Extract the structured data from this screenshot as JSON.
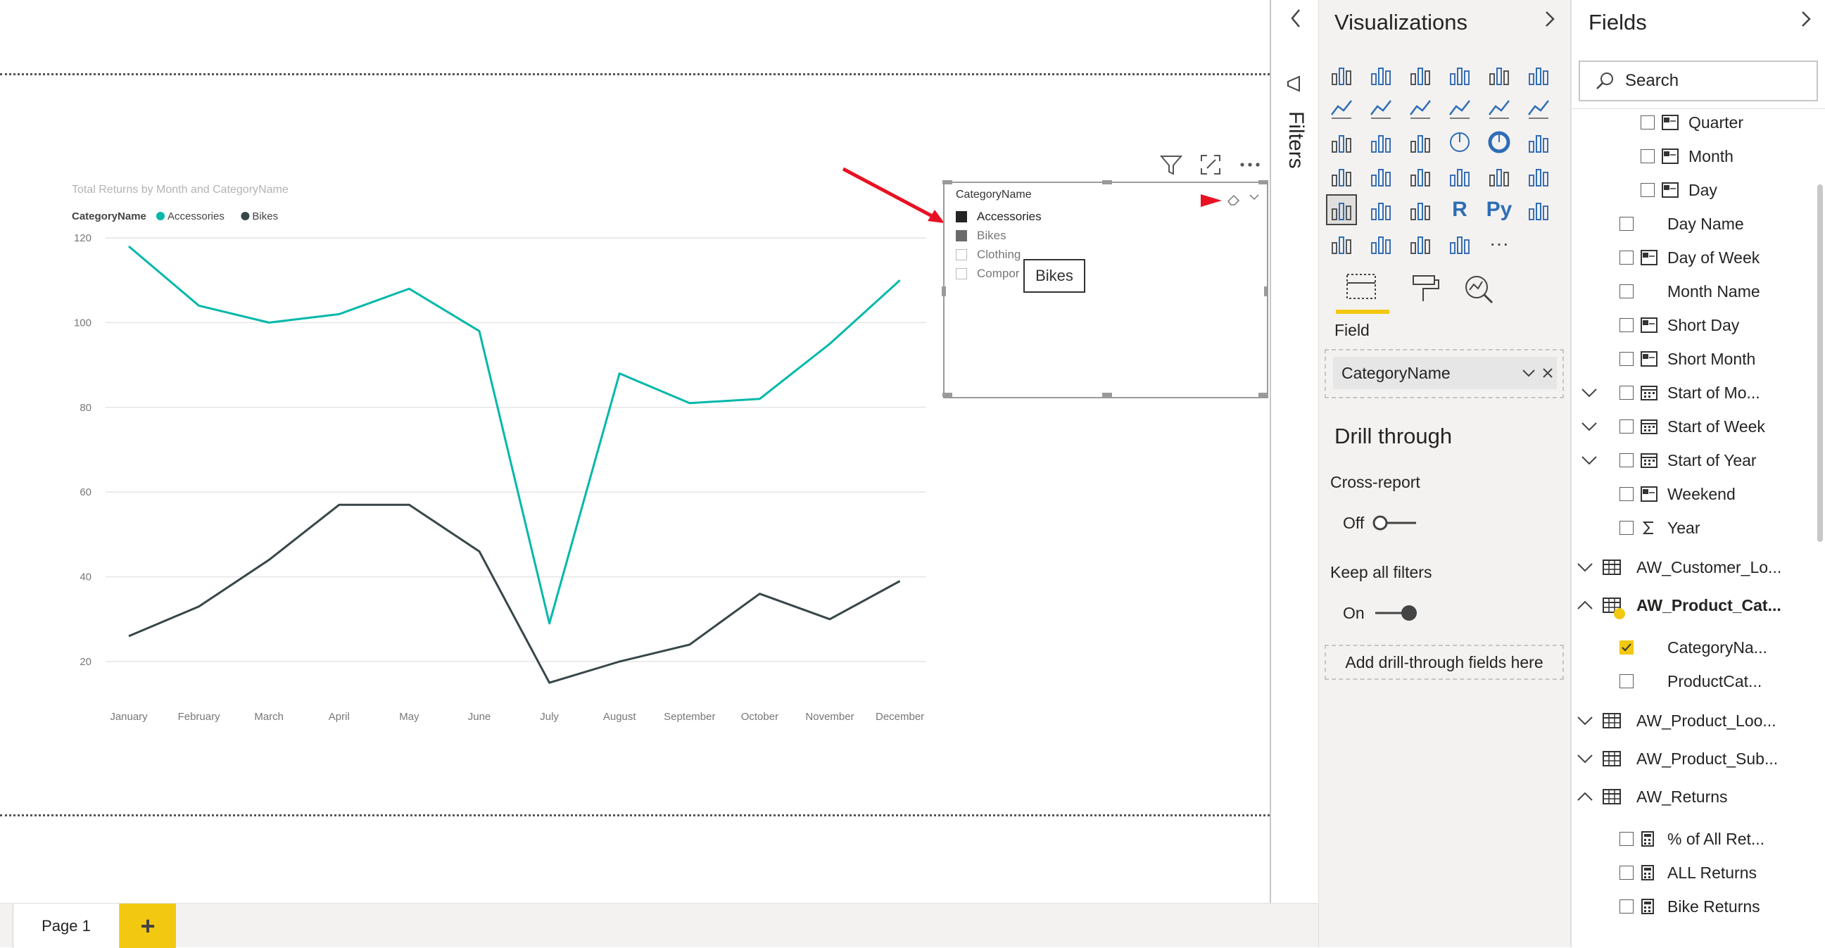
{
  "canvas": {
    "visual_header": {
      "filter_icon": "filter-icon",
      "focus_icon": "focus-mode-icon",
      "more_icon": "more-options-icon"
    }
  },
  "chart_data": {
    "type": "line",
    "title": "Total Returns by Month and CategoryName",
    "legend_title": "CategoryName",
    "legend_placement": "top-left",
    "categories": [
      "January",
      "February",
      "March",
      "April",
      "May",
      "June",
      "July",
      "August",
      "September",
      "October",
      "November",
      "December"
    ],
    "series": [
      {
        "name": "Accessories",
        "color": "#01b8aa",
        "values": [
          118,
          104,
          100,
          102,
          108,
          98,
          29,
          88,
          81,
          82,
          95,
          110
        ]
      },
      {
        "name": "Bikes",
        "color": "#374649",
        "values": [
          26,
          33,
          44,
          57,
          57,
          46,
          15,
          20,
          24,
          36,
          30,
          39
        ]
      }
    ],
    "yticks": [
      "120",
      "100",
      "80",
      "60",
      "40",
      "20"
    ],
    "ylim": [
      15,
      125
    ],
    "grid": true
  },
  "slicer": {
    "title": "CategoryName",
    "items": [
      {
        "label": "Accessories",
        "state": "selected"
      },
      {
        "label": "Bikes",
        "state": "hover"
      },
      {
        "label": "Clothing",
        "state": "unchecked"
      },
      {
        "label": "Compor",
        "state": "unchecked"
      }
    ],
    "tooltip": "Bikes"
  },
  "tabs": {
    "page1": "Page 1",
    "add": "+"
  },
  "filters": {
    "label": "Filters"
  },
  "visualizations": {
    "title": "Visualizations",
    "field_section": "Field",
    "field_value": "CategoryName",
    "drill_through": "Drill through",
    "cross_report": "Cross-report",
    "cross_report_state": "Off",
    "keep_filters": "Keep all filters",
    "keep_filters_state": "On",
    "drill_placeholder": "Add drill-through fields here",
    "more": "···"
  },
  "fields": {
    "title": "Fields",
    "search_placeholder": "Search",
    "items": [
      {
        "label": "Quarter"
      },
      {
        "label": "Month"
      },
      {
        "label": "Day"
      },
      {
        "label": "Day Name"
      },
      {
        "label": "Day of Week"
      },
      {
        "label": "Month Name"
      },
      {
        "label": "Short Day"
      },
      {
        "label": "Short Month"
      },
      {
        "label": "Start of Mo..."
      },
      {
        "label": "Start of Week"
      },
      {
        "label": "Start of Year"
      },
      {
        "label": "Weekend"
      },
      {
        "label": "Year"
      },
      {
        "label": "AW_Customer_Lo..."
      },
      {
        "label": "AW_Product_Cat..."
      },
      {
        "label": "CategoryNa..."
      },
      {
        "label": "ProductCat..."
      },
      {
        "label": "AW_Product_Loo..."
      },
      {
        "label": "AW_Product_Sub..."
      },
      {
        "label": "AW_Returns"
      },
      {
        "label": "% of All Ret..."
      },
      {
        "label": "ALL Returns"
      },
      {
        "label": "Bike Returns"
      }
    ]
  }
}
